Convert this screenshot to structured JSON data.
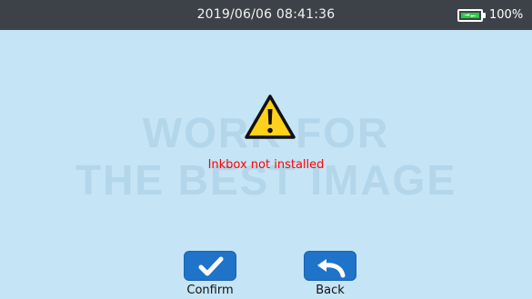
{
  "status_bar": {
    "datetime": "2019/06/06 08:41:36",
    "battery_percent": "100%",
    "battery_icon": "battery-charging-icon",
    "battery_fill_color": "#27c93f"
  },
  "watermark": {
    "line1": "WORK FOR",
    "line2": "THE BEST IMAGE"
  },
  "dialog": {
    "icon": "warning-icon",
    "message": "Inkbox not installed",
    "message_color": "#ff0000"
  },
  "buttons": {
    "confirm": {
      "label": "Confirm",
      "icon": "checkmark-icon"
    },
    "back": {
      "label": "Back",
      "icon": "back-arrow-icon"
    }
  }
}
